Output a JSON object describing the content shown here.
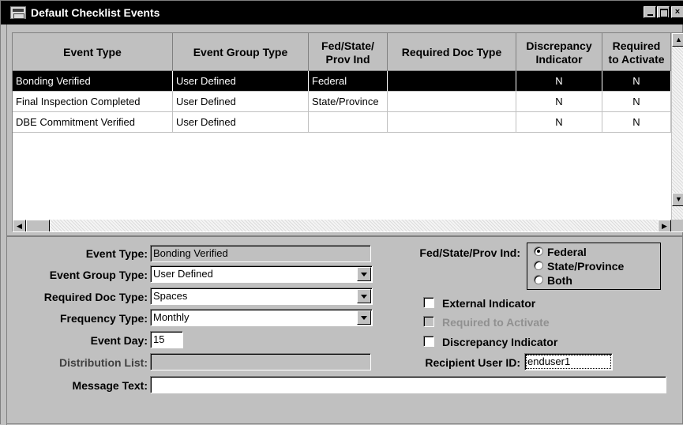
{
  "window": {
    "title": "Default Checklist Events"
  },
  "grid": {
    "columns": [
      "Event Type",
      "Event Group Type",
      "Fed/State/\nProv Ind",
      "Required Doc Type",
      "Discrepancy\nIndicator",
      "Required\nto Activate"
    ],
    "rows": [
      {
        "event_type": "Bonding Verified",
        "group": "User Defined",
        "fed": "Federal",
        "doc": "",
        "disc": "N",
        "req": "N",
        "selected": true
      },
      {
        "event_type": "Final Inspection Completed",
        "group": "User Defined",
        "fed": "State/Province",
        "doc": "",
        "disc": "N",
        "req": "N",
        "selected": false
      },
      {
        "event_type": "DBE Commitment Verified",
        "group": "User Defined",
        "fed": "",
        "doc": "",
        "disc": "N",
        "req": "N",
        "selected": false
      }
    ]
  },
  "form": {
    "event_type_label": "Event Type:",
    "event_type_value": "Bonding Verified",
    "event_group_type_label": "Event Group Type:",
    "event_group_type_value": "User Defined",
    "required_doc_type_label": "Required Doc Type:",
    "required_doc_type_value": "Spaces",
    "frequency_type_label": "Frequency Type:",
    "frequency_type_value": "Monthly",
    "event_day_label": "Event Day:",
    "event_day_value": "15",
    "distribution_list_label": "Distribution List:",
    "distribution_list_value": "",
    "message_text_label": "Message Text:",
    "message_text_value": "",
    "fed_state_label": "Fed/State/Prov Ind:",
    "radio_options": [
      "Federal",
      "State/Province",
      "Both"
    ],
    "radio_selected": "Federal",
    "external_indicator_label": "External Indicator",
    "required_to_activate_label": "Required to Activate",
    "discrepancy_indicator_label": "Discrepancy Indicator",
    "recipient_user_id_label": "Recipient User ID:",
    "recipient_user_id_value": "enduser1"
  }
}
